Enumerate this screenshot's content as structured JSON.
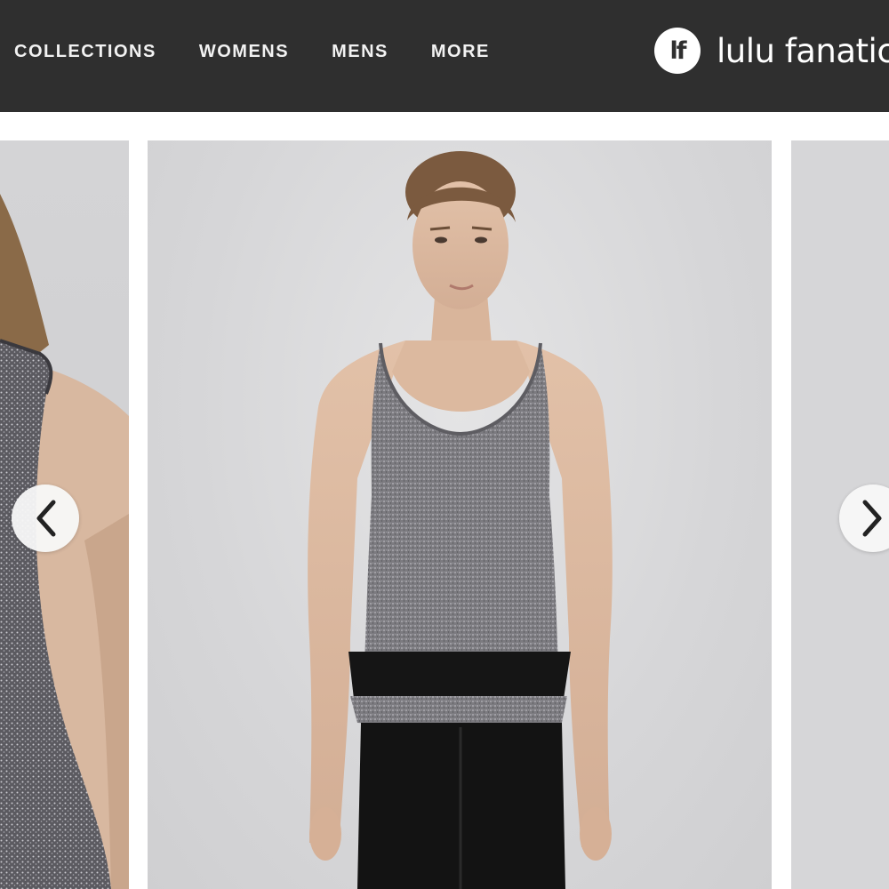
{
  "header": {
    "nav": [
      "COLLECTIONS",
      "WOMENS",
      "MENS",
      "MORE"
    ],
    "brand": {
      "badge": "lf",
      "name": "lulu fanatics"
    }
  },
  "carousel": {
    "prev_icon": "chevron-left-icon",
    "next_icon": "chevron-right-icon",
    "slides": [
      "product-photo-back-view",
      "product-photo-front-view",
      "product-photo-side-view"
    ]
  },
  "colors": {
    "header_bg": "#2f2f2f",
    "header_text": "#f2f2f2",
    "photo_bg": "#d9d9da",
    "tank_grey": "#8a8a8e",
    "tank_band": "#151515"
  }
}
